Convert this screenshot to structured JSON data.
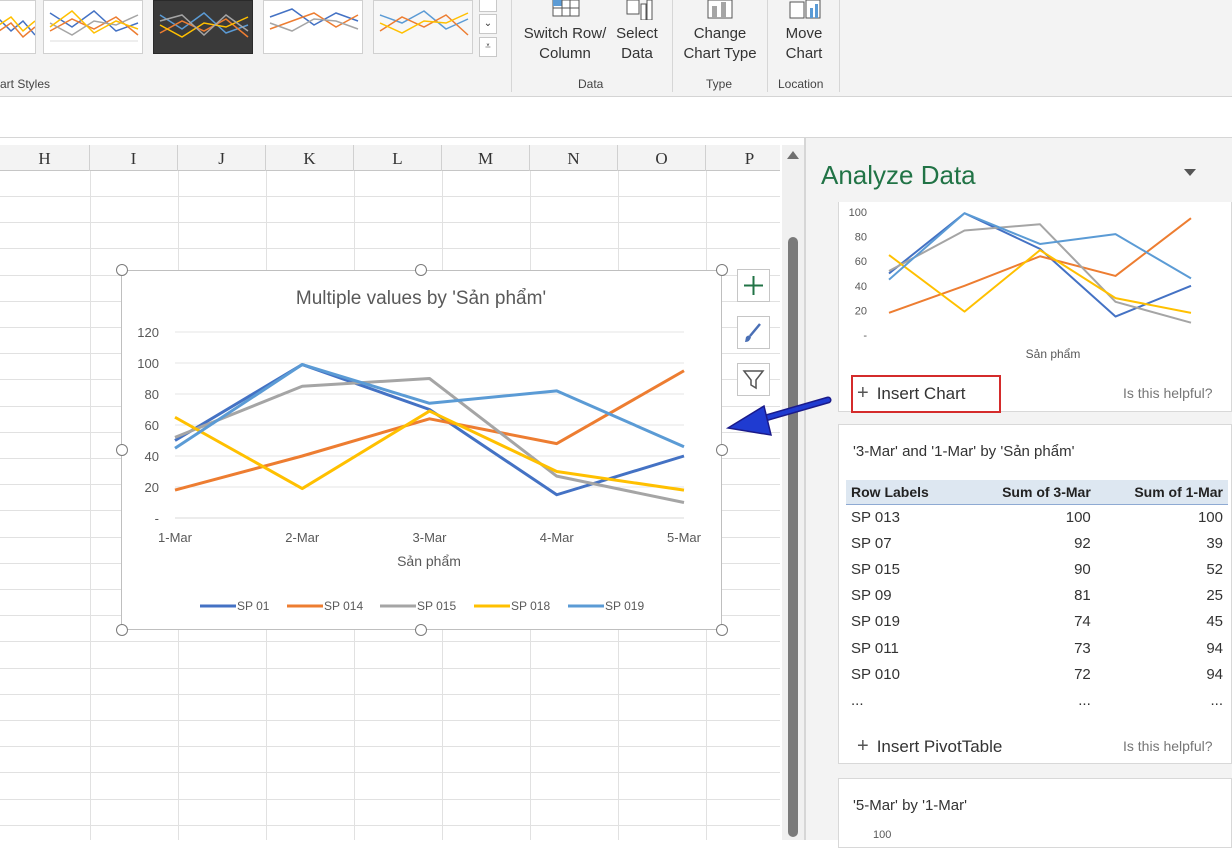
{
  "ribbon": {
    "chart_styles_label": "art Styles",
    "gallery_more": [
      "⌃",
      "⌄",
      "⩡"
    ],
    "data_group_label": "Data",
    "type_group_label": "Type",
    "location_group_label": "Location",
    "switch_row_column": "Switch Row/\nColumn",
    "select_data": "Select\nData",
    "change_chart_type": "Change\nChart Type",
    "move_chart": "Move\nChart"
  },
  "sheet": {
    "columns": [
      "H",
      "I",
      "J",
      "K",
      "L",
      "M",
      "N",
      "O",
      "P"
    ]
  },
  "chart_data": {
    "type": "line",
    "title": "Multiple values by 'Sản phẩm'",
    "xlabel": "Sản phẩm",
    "ylabel": "",
    "categories": [
      "1-Mar",
      "2-Mar",
      "3-Mar",
      "4-Mar",
      "5-Mar"
    ],
    "y_ticks": [
      "-",
      "20",
      "40",
      "60",
      "80",
      "100",
      "120"
    ],
    "ylim": [
      0,
      120
    ],
    "grid": true,
    "legend_position": "bottom",
    "series": [
      {
        "name": "SP 01",
        "color": "#4472c4",
        "values": [
          50,
          99,
          70,
          15,
          40
        ]
      },
      {
        "name": "SP 014",
        "color": "#ed7d31",
        "values": [
          18,
          40,
          64,
          48,
          95
        ]
      },
      {
        "name": "SP 015",
        "color": "#a5a5a5",
        "values": [
          52,
          85,
          90,
          27,
          10
        ]
      },
      {
        "name": "SP 018",
        "color": "#ffc000",
        "values": [
          65,
          19,
          69,
          30,
          18
        ]
      },
      {
        "name": "SP 019",
        "color": "#5b9bd5",
        "values": [
          45,
          99,
          74,
          82,
          46
        ]
      }
    ]
  },
  "panel": {
    "title": "Analyze Data",
    "card1": {
      "y_ticks": [
        "-",
        "20",
        "40",
        "60",
        "80",
        "100"
      ],
      "xlabel": "Sản phẩm",
      "insert_label": "Insert Chart",
      "helpful": "Is this helpful?"
    },
    "card2": {
      "title": "'3-Mar' and '1-Mar' by 'Sản phẩm'",
      "headers": [
        "Row Labels",
        "Sum of 3-Mar",
        "Sum of 1-Mar"
      ],
      "rows": [
        [
          "SP 013",
          "100",
          "100"
        ],
        [
          "SP 07",
          "92",
          "39"
        ],
        [
          "SP 015",
          "90",
          "52"
        ],
        [
          "SP 09",
          "81",
          "25"
        ],
        [
          "SP 019",
          "74",
          "45"
        ],
        [
          "SP 011",
          "73",
          "94"
        ],
        [
          "SP 010",
          "72",
          "94"
        ],
        [
          "...",
          "...",
          "..."
        ]
      ],
      "insert_label": "Insert PivotTable",
      "helpful": "Is this helpful?"
    },
    "card3": {
      "title": "'5-Mar' by '1-Mar'",
      "y_tick": "100"
    }
  },
  "colors": {
    "accent_green": "#217346",
    "highlight_red": "#d42b2b",
    "arrow_blue": "#1f3bd1"
  }
}
